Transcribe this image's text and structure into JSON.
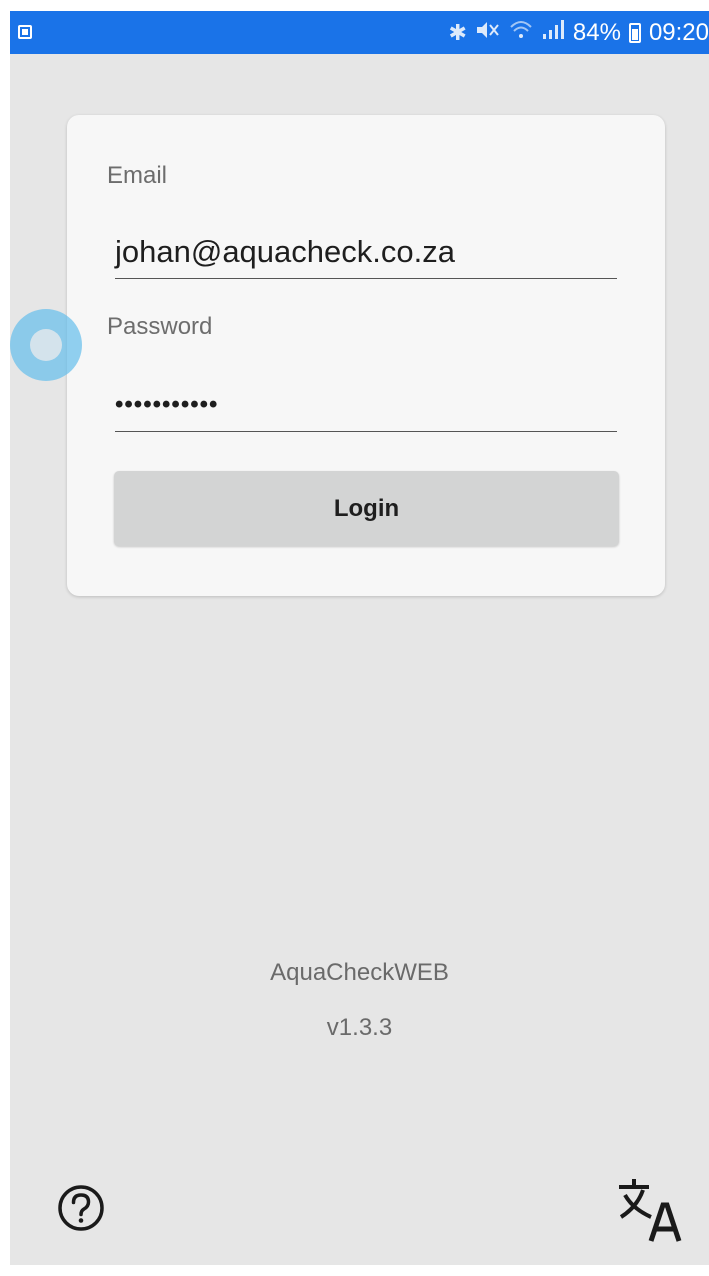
{
  "status_bar": {
    "battery_percent": "84%",
    "time": "09:20",
    "icons": [
      "notification-icon",
      "bluetooth-icon",
      "mute-icon",
      "wifi-icon",
      "signal-icon",
      "battery-icon"
    ],
    "color": "#1a73e8"
  },
  "login_form": {
    "email_label": "Email",
    "email_value": "johan@aquacheck.co.za",
    "password_label": "Password",
    "password_value": "•••••••••••",
    "login_label": "Login"
  },
  "footer": {
    "app_name": "AquaCheckWEB",
    "version": "v1.3.3",
    "icons": [
      "help-icon",
      "translate-icon"
    ]
  }
}
